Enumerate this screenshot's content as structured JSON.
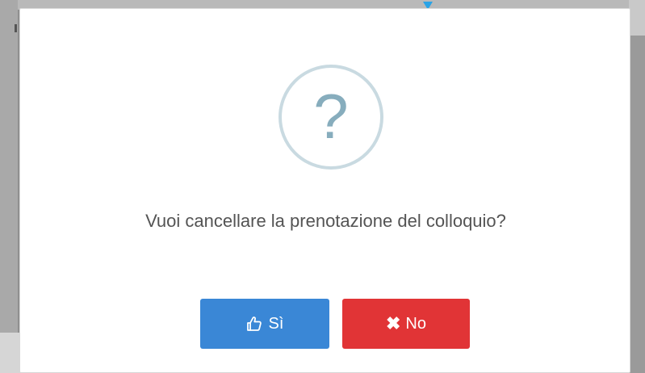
{
  "dialog": {
    "icon": "question-mark-icon",
    "icon_glyph": "?",
    "message": "Vuoi cancellare la prenotazione del colloquio?",
    "buttons": {
      "yes_label": "Sì",
      "yes_icon": "thumbs-up-icon",
      "no_label": "No",
      "no_icon": "close-icon",
      "no_icon_glyph": "✖"
    },
    "colors": {
      "yes_button": "#3a87d6",
      "no_button": "#e13436",
      "icon_circle": "#c9dae1",
      "icon_glyph": "#87adbd",
      "message_text": "#545454"
    }
  }
}
